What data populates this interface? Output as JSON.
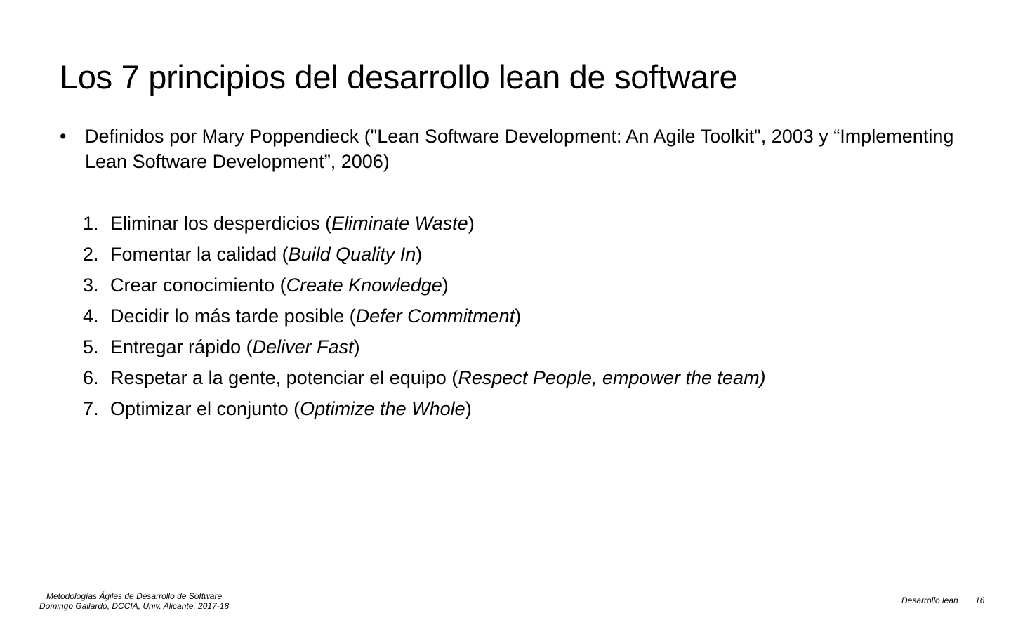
{
  "title": "Los 7 principios del desarrollo lean de software",
  "bullet": {
    "marker": "•",
    "text": "Definidos por Mary Poppendieck (\"Lean Software Development: An Agile Toolkit\", 2003 y “Implementing Lean Software Development”, 2006)"
  },
  "principles": [
    {
      "number": "1.",
      "spanish": "Eliminar los desperdicios (",
      "english": "Eliminate Waste",
      "close": ")"
    },
    {
      "number": "2.",
      "spanish": "Fomentar la calidad (",
      "english": "Build Quality In",
      "close": ")"
    },
    {
      "number": "3.",
      "spanish": "Crear conocimiento (",
      "english": "Create Knowledge",
      "close": ")"
    },
    {
      "number": "4.",
      "spanish": "Decidir lo más tarde posible (",
      "english": "Defer Commitment",
      "close": ")"
    },
    {
      "number": "5.",
      "spanish": "Entregar rápido (",
      "english": "Deliver Fast",
      "close": ")"
    },
    {
      "number": "6.",
      "spanish": "Respetar a la gente, potenciar el equipo (",
      "english": "Respect People, empower the team)",
      "close": ""
    },
    {
      "number": "7.",
      "spanish": "Optimizar el conjunto (",
      "english": "Optimize the Whole",
      "close": ")"
    }
  ],
  "footer": {
    "course": "Metodologías Ágiles de Desarrollo de Software",
    "author": "Domingo Gallardo, DCCIA, Univ. Alicante, 2017-18",
    "section": "Desarrollo lean",
    "page": "16"
  }
}
